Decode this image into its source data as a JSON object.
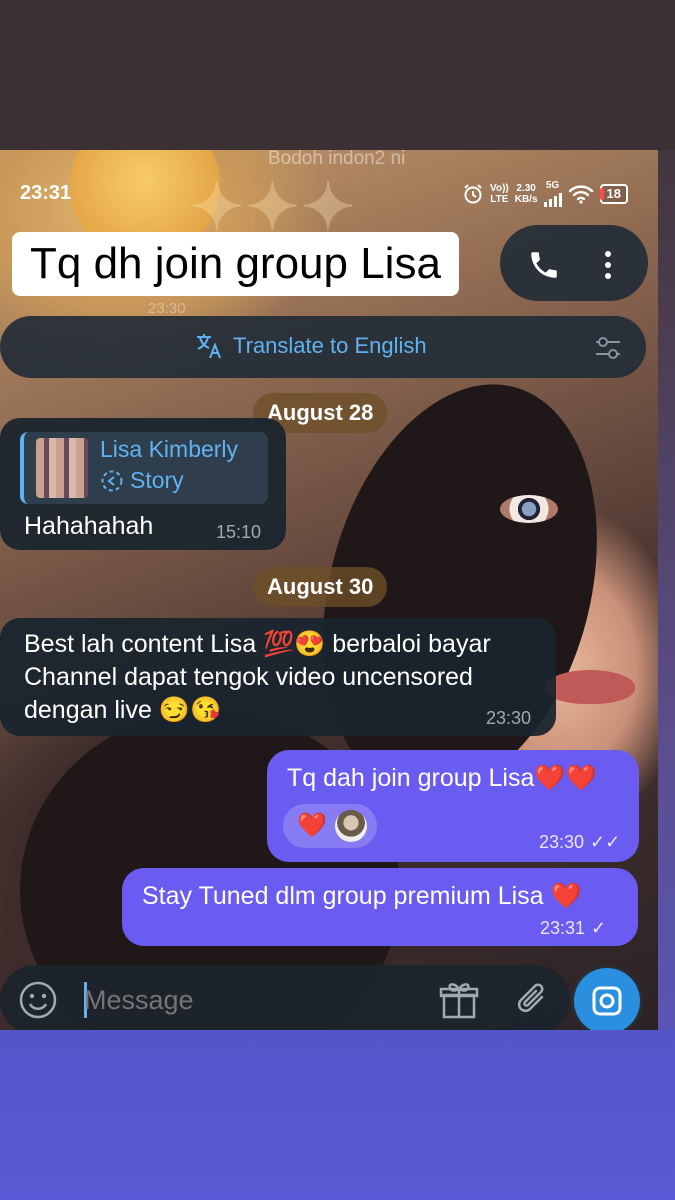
{
  "background_watermark": {
    "header_text": "Bodoh indon2 ni",
    "time_text": "23:30"
  },
  "status_bar": {
    "time": "23:31",
    "volte_top": "Vo))",
    "volte_bottom": "LTE",
    "speed_top": "2.30",
    "speed_bottom": "KB/s",
    "network": "5G",
    "battery": "18"
  },
  "header": {
    "title": "Tq dh join group Lisa"
  },
  "translate_bar": {
    "label": "Translate to English"
  },
  "dates": {
    "first": "August 28",
    "second": "August 30"
  },
  "messages": {
    "m1": {
      "reply_name": "Lisa Kimberly",
      "reply_sub": "Story",
      "text": "Hahahahah",
      "time": "15:10"
    },
    "m2": {
      "line1": "Best lah content Lisa 💯😍 berbaloi bayar",
      "line2": "Channel dapat tengok video uncensored",
      "line3": "dengan live 😏😘",
      "time": "23:30"
    },
    "m3": {
      "text": "Tq dah join group Lisa❤️❤️",
      "reaction": "❤️",
      "time": "23:30",
      "status": "✓✓"
    },
    "m4": {
      "text": "Stay Tuned dlm group premium Lisa ❤️",
      "time": "23:31",
      "status": "✓"
    }
  },
  "input": {
    "placeholder": "Message"
  },
  "colors": {
    "accent_blue": "#5fb3f0",
    "outgoing_bubble": "#6a5cf0",
    "incoming_bubble": "#1a242e"
  }
}
